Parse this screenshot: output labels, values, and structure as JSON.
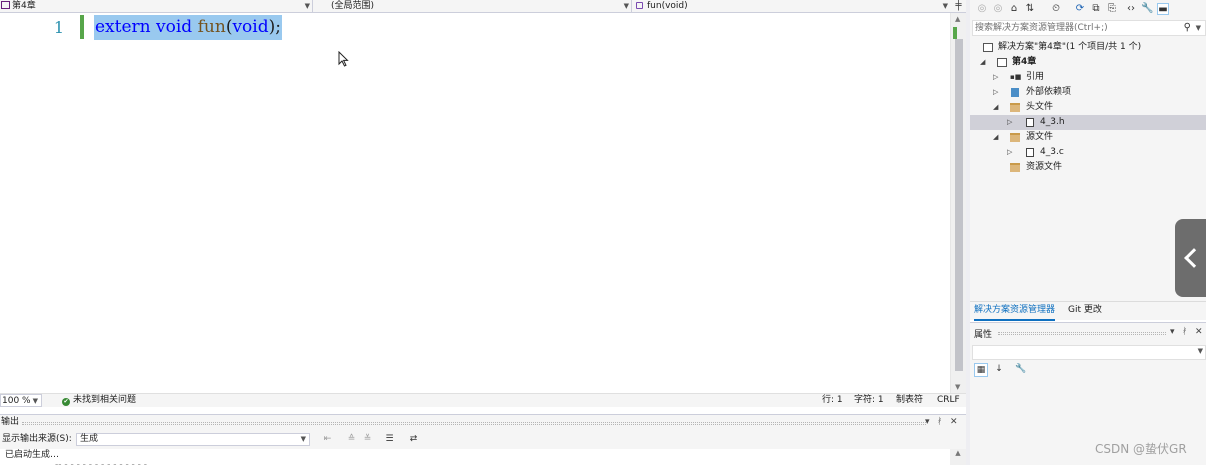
{
  "nav": {
    "project": "第4章",
    "scope": "(全局范围)",
    "member": "fun(void)",
    "split_icon": "split-window-icon"
  },
  "editor": {
    "line_number": "1",
    "code": {
      "kw1": "extern",
      "kw2": "void",
      "fn": "fun",
      "open": "(",
      "arg": "void",
      "close": ");"
    },
    "selection_color": "#99c9ef"
  },
  "status": {
    "zoom": "100 %",
    "issues": "未找到相关问题",
    "line": "行: 1",
    "char": "字符: 1",
    "indent": "制表符",
    "eol": "CRLF"
  },
  "output": {
    "title": "输出",
    "source_label": "显示输出来源(S):",
    "source_value": "生成",
    "text": "已启动生成…"
  },
  "solution_explorer": {
    "search_placeholder": "搜索解决方案资源管理器(Ctrl+;)",
    "tree": [
      {
        "label": "解决方案\"第4章\"(1 个项目/共 1 个)",
        "icon": "solution-icon"
      },
      {
        "label": "第4章",
        "icon": "project-icon"
      },
      {
        "label": "引用",
        "icon": "references-icon"
      },
      {
        "label": "外部依赖项",
        "icon": "external-deps-icon"
      },
      {
        "label": "头文件",
        "icon": "folder-icon"
      },
      {
        "label": "4_3.h",
        "icon": "header-file-icon"
      },
      {
        "label": "源文件",
        "icon": "folder-icon"
      },
      {
        "label": "4_3.c",
        "icon": "source-file-icon"
      },
      {
        "label": "资源文件",
        "icon": "folder-icon"
      }
    ],
    "tabs": [
      "解决方案资源管理器",
      "Git 更改"
    ]
  },
  "properties": {
    "title": "属性"
  },
  "watermark": "CSDN @蛰伏GR"
}
